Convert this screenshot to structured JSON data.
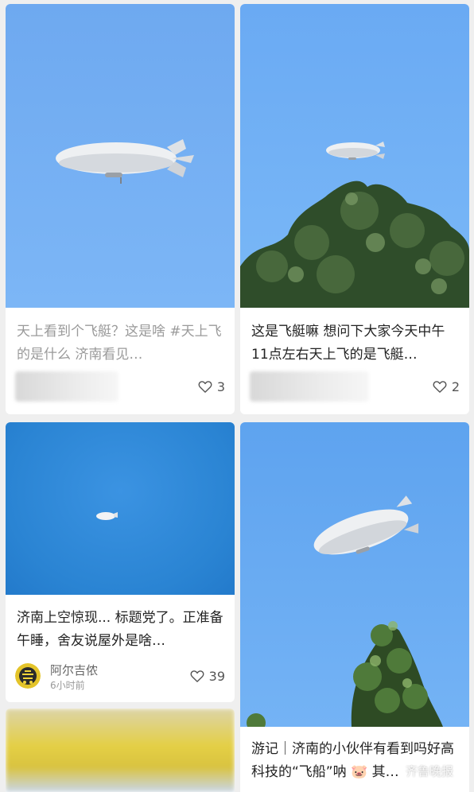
{
  "feed": {
    "cards": [
      {
        "title": "天上看到个飞艇？这是啥 #天上飞的是什么  济南看见…",
        "likes": "3"
      },
      {
        "title": "这是飞艇嘛 想问下大家今天中午11点左右天上飞的是飞艇…",
        "likes": "2"
      },
      {
        "title": "济南上空惊现... 标题党了。正准备午睡，舍友说屋外是啥…",
        "author": "阿尔吉侬",
        "time": "6小时前",
        "likes": "39"
      },
      {
        "title": "游记｜济南的小伙伴有看到吗好高科技的“飞船”呐 🐷 其…"
      }
    ]
  },
  "watermark": "齐鲁晚报",
  "colors": {
    "sky_light": "#7fb5f5",
    "sky_deep": "#2f86d6",
    "card_bg": "#ffffff",
    "page_bg": "#efefef"
  },
  "icons": [
    "heart-outline-icon",
    "avatar-icon"
  ]
}
